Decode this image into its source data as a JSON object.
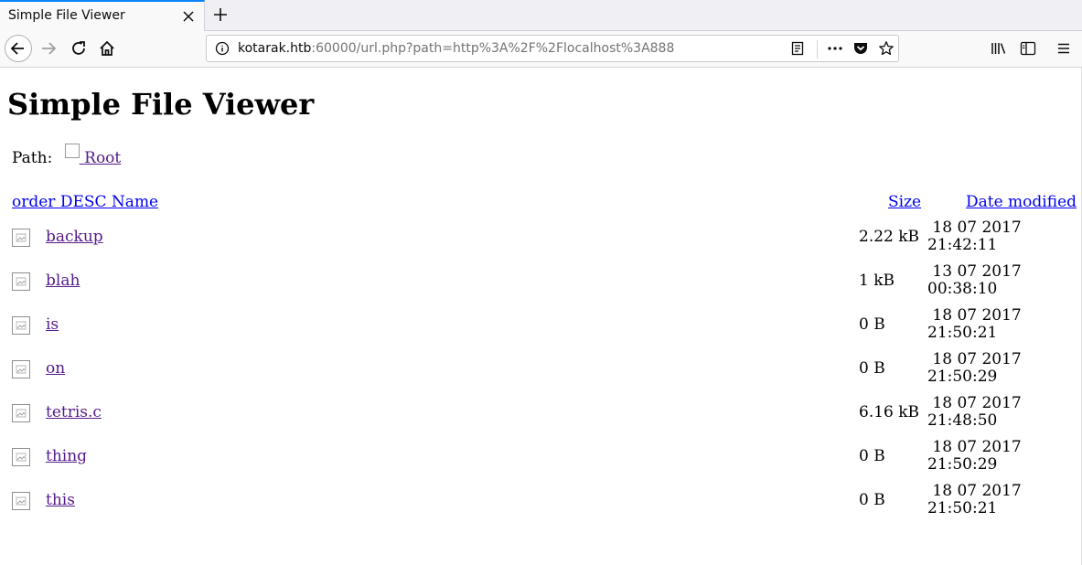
{
  "browser": {
    "tab_title": "Simple File Viewer",
    "url_host": "kotarak.htb",
    "url_rest": ":60000/url.php?path=http%3A%2F%2Flocalhost%3A888"
  },
  "icons": {
    "tab_close": "close-icon",
    "new_tab": "plus-icon",
    "back": "back-arrow-icon",
    "forward": "forward-arrow-icon",
    "reload": "reload-icon",
    "home": "home-icon",
    "site_info": "info-icon",
    "reader": "reader-view-icon",
    "more": "ellipsis-icon",
    "pocket": "pocket-icon",
    "bookmark": "star-icon",
    "library": "library-icon",
    "sidebar": "sidebar-icon",
    "menu": "hamburger-menu-icon",
    "file": "broken-image-icon"
  },
  "colors": {
    "visited_link": "#551a8b",
    "link": "#0000ee",
    "tab_accent": "#0a84ff"
  },
  "page": {
    "title": "Simple File Viewer",
    "path_label": "Path:",
    "root_link": "Root",
    "headers": {
      "name": "order DESC Name",
      "size": "Size",
      "date": "Date modified"
    },
    "files": [
      {
        "name": "backup",
        "size": "2.22 kB",
        "date": "18 07 2017",
        "time": "21:42:11"
      },
      {
        "name": "blah",
        "size": "1 kB",
        "date": "13 07 2017",
        "time": "00:38:10"
      },
      {
        "name": "is",
        "size": "0 B",
        "date": "18 07 2017",
        "time": "21:50:21"
      },
      {
        "name": "on",
        "size": "0 B",
        "date": "18 07 2017",
        "time": "21:50:29"
      },
      {
        "name": "tetris.c",
        "size": "6.16 kB",
        "date": "18 07 2017",
        "time": "21:48:50"
      },
      {
        "name": "thing",
        "size": "0 B",
        "date": "18 07 2017",
        "time": "21:50:29"
      },
      {
        "name": "this",
        "size": "0 B",
        "date": "18 07 2017",
        "time": "21:50:21"
      }
    ]
  }
}
